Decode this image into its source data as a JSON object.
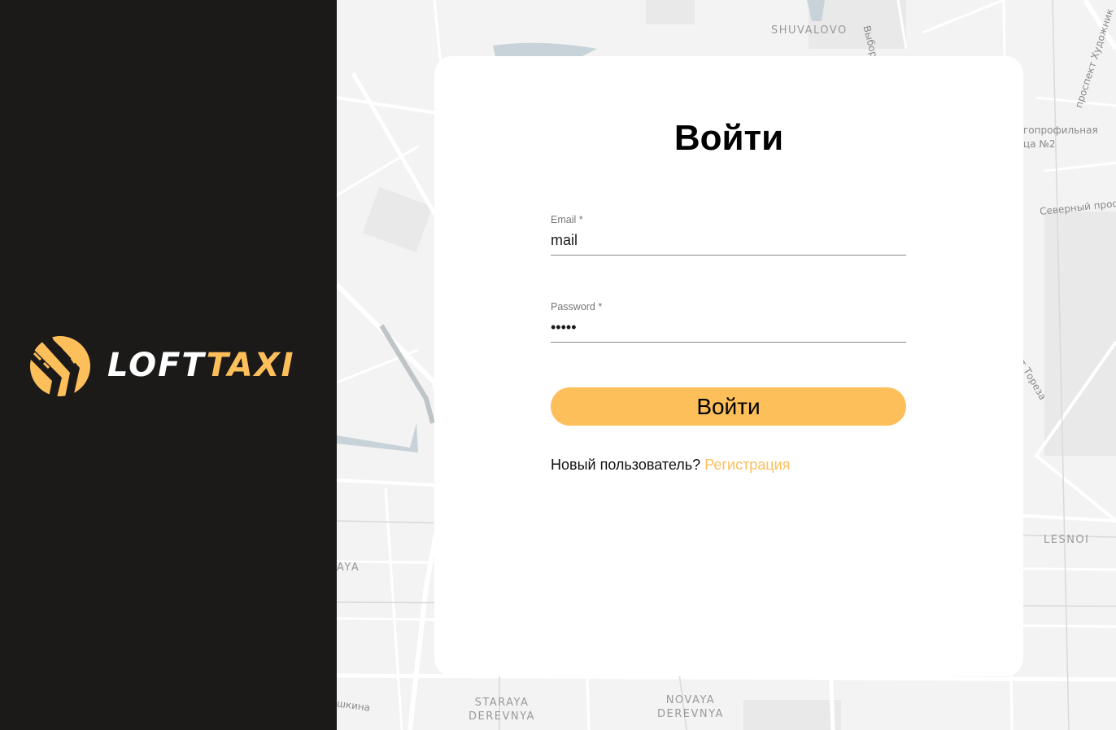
{
  "colors": {
    "sidebar": "#1c1a19",
    "accent": "#fdbf5a",
    "card": "#ffffff",
    "map": "#f3f3f3"
  },
  "sidebar": {
    "logo": {
      "icon": "taxi-road-logo-icon",
      "word_primary": "LOFT",
      "word_accent": "TAXI"
    }
  },
  "map": {
    "labels": [
      {
        "name": "map-label-shuvalovo",
        "text": "SHUVALOVO"
      },
      {
        "name": "map-label-vyborgskoe",
        "text": "Выборгск"
      },
      {
        "name": "map-label-khudozhnikov",
        "text": "проспект Художник"
      },
      {
        "name": "map-label-gimnazia",
        "text": "гопрофильная\nца №2"
      },
      {
        "name": "map-label-severny",
        "text": "Северный прос"
      },
      {
        "name": "map-label-toreza",
        "text": "т Тореза"
      },
      {
        "name": "map-label-lesnoi",
        "text": "LESNOI"
      },
      {
        "name": "map-label-aya",
        "text": "AYA"
      },
      {
        "name": "map-label-shkina",
        "text": "шкина"
      },
      {
        "name": "map-label-staraya",
        "text": "STARAYA\nDEREVNYA"
      },
      {
        "name": "map-label-novaya",
        "text": "NOVAYA\nDEREVNYA"
      }
    ]
  },
  "login": {
    "title": "Войти",
    "email": {
      "label": "Email *",
      "value": "mail"
    },
    "password": {
      "label": "Password *",
      "value": "•••••"
    },
    "submit_label": "Войти",
    "new_user_text": "Новый пользователь?",
    "register_link": "Регистрация"
  }
}
